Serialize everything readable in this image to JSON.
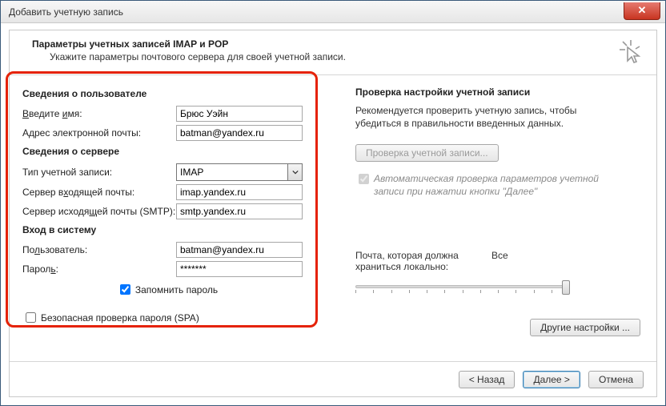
{
  "window": {
    "title": "Добавить учетную запись"
  },
  "header": {
    "title": "Параметры учетных записей IMAP и POP",
    "subtitle": "Укажите параметры почтового сервера для своей учетной записи."
  },
  "left": {
    "section_user": "Сведения о пользователе",
    "name_label": "Введите имя:",
    "name_value": "Брюс Уэйн",
    "email_label": "Адрес электронной почты:",
    "email_value": "batman@yandex.ru",
    "section_server": "Сведения о сервере",
    "acct_type_label": "Тип учетной записи:",
    "acct_type_value": "IMAP",
    "incoming_label": "Сервер входящей почты:",
    "incoming_value": "imap.yandex.ru",
    "outgoing_label": "Сервер исходящей почты (SMTP):",
    "outgoing_value": "smtp.yandex.ru",
    "section_login": "Вход в систему",
    "user_label": "Пользователь:",
    "user_value": "batman@yandex.ru",
    "pass_label": "Пароль:",
    "pass_value": "*******",
    "remember_label": "Запомнить пароль",
    "spa_label": "Безопасная проверка пароля (SPA)"
  },
  "right": {
    "title": "Проверка настройки учетной записи",
    "desc": "Рекомендуется проверить учетную запись, чтобы убедиться в правильности введенных данных.",
    "test_button": "Проверка учетной записи...",
    "auto_test_label": "Автоматическая проверка параметров учетной записи при нажатии кнопки \"Далее\"",
    "storage_label": "Почта, которая должна храниться локально:",
    "storage_value": "Все",
    "other_settings_button": "Другие настройки ..."
  },
  "footer": {
    "back": "< Назад",
    "next": "Далее >",
    "cancel": "Отмена"
  }
}
